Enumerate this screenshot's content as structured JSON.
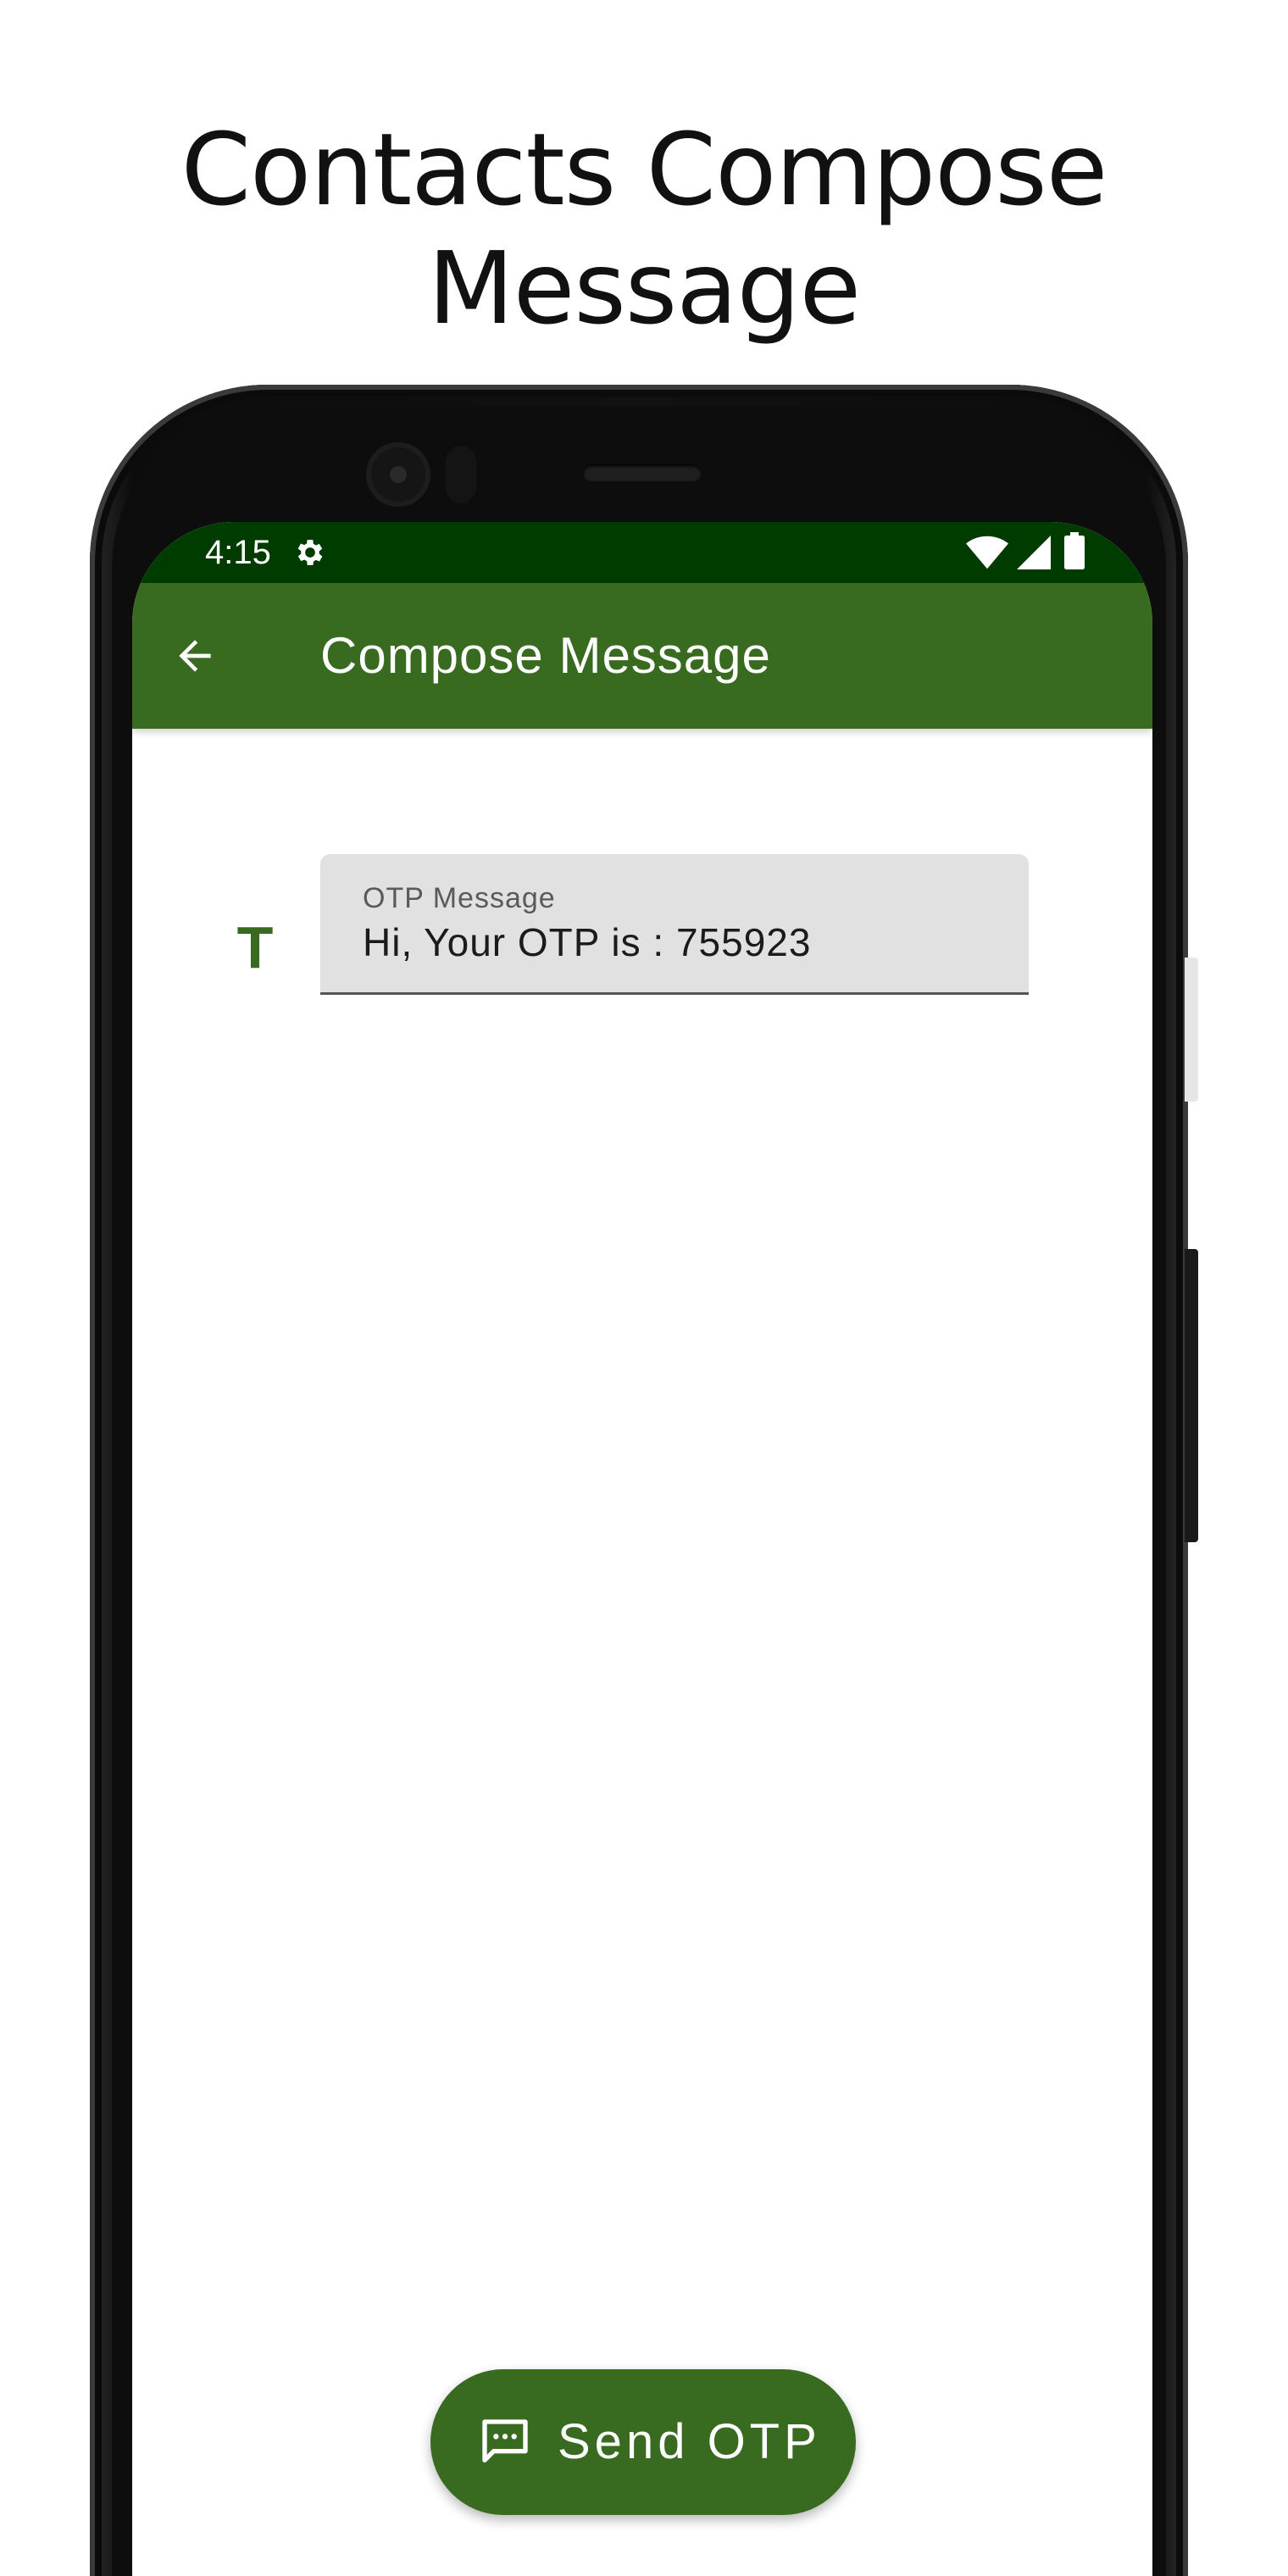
{
  "promo": {
    "title_line1": "Contacts Compose",
    "title_line2": "Message"
  },
  "status_bar": {
    "time": "4:15",
    "icons": [
      "settings-icon",
      "wifi-icon",
      "signal-icon",
      "battery-icon"
    ]
  },
  "app_bar": {
    "title": "Compose Message",
    "back_icon": "arrow-back-icon"
  },
  "form": {
    "leading_icon_text": "T",
    "otp_field": {
      "label": "OTP Message",
      "value": "Hi, Your OTP is : 755923"
    }
  },
  "fab": {
    "label": "Send OTP",
    "icon": "message-icon"
  },
  "colors": {
    "status_bar": "#003c00",
    "primary": "#386a20",
    "field_background": "#e1e1e1"
  }
}
